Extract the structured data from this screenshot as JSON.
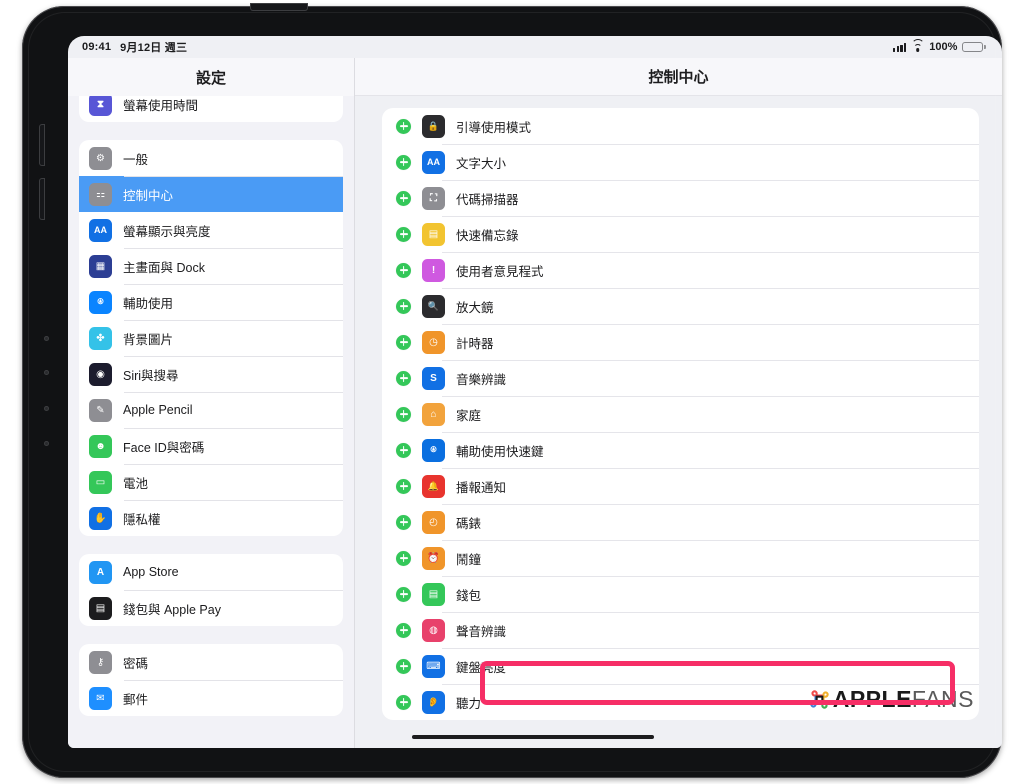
{
  "status_bar": {
    "time": "09:41",
    "date": "9月12日 週三",
    "battery_percent": "100%",
    "signal_icon": "cellular-bars-icon",
    "wifi_icon": "wifi-icon",
    "battery_icon": "battery-full-icon"
  },
  "sidebar": {
    "title": "設定",
    "groups": [
      {
        "partial": true,
        "items": [
          {
            "label": "螢幕使用時間",
            "icon": "hourglass-icon",
            "color": "#5856d6",
            "glyph": "⧗",
            "selected": false
          }
        ]
      },
      {
        "partial": false,
        "items": [
          {
            "label": "一般",
            "icon": "gear-icon",
            "color": "#8e8e93",
            "glyph": "⚙",
            "selected": false
          },
          {
            "label": "控制中心",
            "icon": "toggles-icon",
            "color": "#8e8e93",
            "glyph": "⚏",
            "selected": true
          },
          {
            "label": "螢幕顯示與亮度",
            "icon": "text-size-icon",
            "color": "#1170e4",
            "glyph": "AA",
            "selected": false
          },
          {
            "label": "主畫面與 Dock",
            "icon": "home-screen-icon",
            "color": "#2c3e94",
            "glyph": "▦",
            "selected": false
          },
          {
            "label": "輔助使用",
            "icon": "accessibility-icon",
            "color": "#0a84ff",
            "glyph": "⍟",
            "selected": false
          },
          {
            "label": "背景圖片",
            "icon": "wallpaper-icon",
            "color": "#34c2e8",
            "glyph": "✤",
            "selected": false
          },
          {
            "label": "Siri與搜尋",
            "icon": "siri-icon",
            "color": "#1c1c2e",
            "glyph": "◉",
            "selected": false
          },
          {
            "label": "Apple Pencil",
            "icon": "pencil-icon",
            "color": "#8e8e93",
            "glyph": "✎",
            "selected": false
          },
          {
            "label": "Face ID與密碼",
            "icon": "face-id-icon",
            "color": "#34c759",
            "glyph": "☻",
            "selected": false
          },
          {
            "label": "電池",
            "icon": "battery-icon",
            "color": "#34c759",
            "glyph": "▭",
            "selected": false
          },
          {
            "label": "隱私權",
            "icon": "privacy-hand-icon",
            "color": "#1170e4",
            "glyph": "✋",
            "selected": false
          }
        ]
      },
      {
        "partial": false,
        "items": [
          {
            "label": "App Store",
            "icon": "app-store-icon",
            "color": "#2196f3",
            "glyph": "A",
            "selected": false
          },
          {
            "label": "錢包與 Apple Pay",
            "icon": "wallet-icon",
            "color": "#1c1c1e",
            "glyph": "▤",
            "selected": false
          }
        ]
      },
      {
        "partial": false,
        "items": [
          {
            "label": "密碼",
            "icon": "key-icon",
            "color": "#8e8e93",
            "glyph": "⚷",
            "selected": false
          },
          {
            "label": "郵件",
            "icon": "mail-icon",
            "color": "#1e8fff",
            "glyph": "✉",
            "selected": false
          }
        ]
      }
    ]
  },
  "detail": {
    "title": "控制中心",
    "add_button_icon": "plus-circle-icon",
    "rows": [
      {
        "label": "引導使用模式",
        "icon": "guided-access-icon",
        "color": "#2b2b2e",
        "glyph": "🔒"
      },
      {
        "label": "文字大小",
        "icon": "text-size-icon",
        "color": "#1170e4",
        "glyph": "AA"
      },
      {
        "label": "代碼掃描器",
        "icon": "code-scanner-icon",
        "color": "#8e8e93",
        "glyph": "⛶"
      },
      {
        "label": "快速備忘錄",
        "icon": "quick-note-icon",
        "color": "#f2c430",
        "glyph": "▤"
      },
      {
        "label": "使用者意見程式",
        "icon": "feedback-icon",
        "color": "#cf59e0",
        "glyph": "!"
      },
      {
        "label": "放大鏡",
        "icon": "magnifier-icon",
        "color": "#2b2b2e",
        "glyph": "🔍"
      },
      {
        "label": "計時器",
        "icon": "timer-icon",
        "color": "#f0952a",
        "glyph": "◷"
      },
      {
        "label": "音樂辨識",
        "icon": "shazam-icon",
        "color": "#1170e4",
        "glyph": "S"
      },
      {
        "label": "家庭",
        "icon": "home-app-icon",
        "color": "#f2a33c",
        "glyph": "⌂"
      },
      {
        "label": "輔助使用快速鍵",
        "icon": "accessibility-shortcut-icon",
        "color": "#0a6fe0",
        "glyph": "⍟"
      },
      {
        "label": "播報通知",
        "icon": "announce-notifications-icon",
        "color": "#e8342e",
        "glyph": "🔔"
      },
      {
        "label": "碼錶",
        "icon": "stopwatch-icon",
        "color": "#f0952a",
        "glyph": "◴"
      },
      {
        "label": "鬧鐘",
        "icon": "alarm-icon",
        "color": "#f0952a",
        "glyph": "⏰"
      },
      {
        "label": "錢包",
        "icon": "wallet-icon",
        "color": "#34c759",
        "glyph": "▤"
      },
      {
        "label": "聲音辨識",
        "icon": "sound-recognition-icon",
        "color": "#e8416b",
        "glyph": "◍"
      },
      {
        "label": "鍵盤亮度",
        "icon": "keyboard-brightness-icon",
        "color": "#1170e4",
        "glyph": "⌨"
      },
      {
        "label": "聽力",
        "icon": "hearing-icon",
        "color": "#1170e4",
        "glyph": "👂"
      }
    ],
    "highlighted_row_label": "鍵盤亮度",
    "highlight_color": "#f62e66"
  },
  "watermark": {
    "command_icon": "command-symbol-icon",
    "bold_text": "APPLE",
    "light_text": "FANS"
  },
  "home_indicator": {
    "name": "home-indicator"
  }
}
